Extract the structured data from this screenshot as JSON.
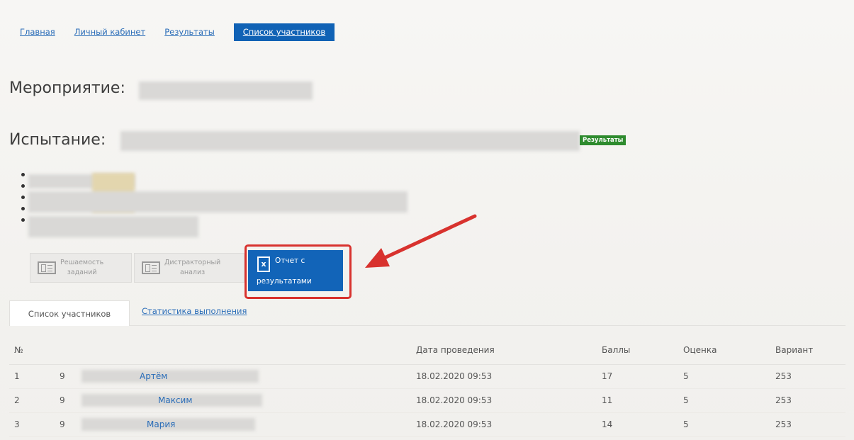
{
  "nav": {
    "items": [
      {
        "label": "Главная",
        "active": false
      },
      {
        "label": "Личный кабинет",
        "active": false
      },
      {
        "label": "Результаты",
        "active": false
      },
      {
        "label": "Список участников",
        "active": true
      }
    ]
  },
  "event": {
    "label": "Мероприятие:"
  },
  "test": {
    "label": "Испытание:",
    "badge": "Результаты"
  },
  "reports": {
    "solvability": {
      "line1": "Решаемость",
      "line2": "заданий"
    },
    "distractor": {
      "line1": "Дистракторный",
      "line2": "анализ"
    },
    "excel": {
      "line1": "Отчет с",
      "line2": "результатами",
      "icon": "excel-icon"
    }
  },
  "tabs": {
    "participants": "Список участников",
    "stats": "Статистика выполнения"
  },
  "table": {
    "headers": {
      "num": "№",
      "date": "Дата проведения",
      "score": "Баллы",
      "grade": "Оценка",
      "variant": "Вариант"
    },
    "rows": [
      {
        "num": "1",
        "cls": "9",
        "name": "Артём",
        "date": "18.02.2020 09:53",
        "score": "17",
        "grade": "5",
        "variant": "253"
      },
      {
        "num": "2",
        "cls": "9",
        "name": "Максим",
        "date": "18.02.2020 09:53",
        "score": "11",
        "grade": "5",
        "variant": "253"
      },
      {
        "num": "3",
        "cls": "9",
        "name": "Мария",
        "date": "18.02.2020 09:53",
        "score": "14",
        "grade": "5",
        "variant": "253"
      }
    ]
  },
  "colors": {
    "accent": "#1062b5",
    "link": "#2a6db8",
    "badge": "#2e8b2e",
    "highlight": "#d8322e"
  }
}
